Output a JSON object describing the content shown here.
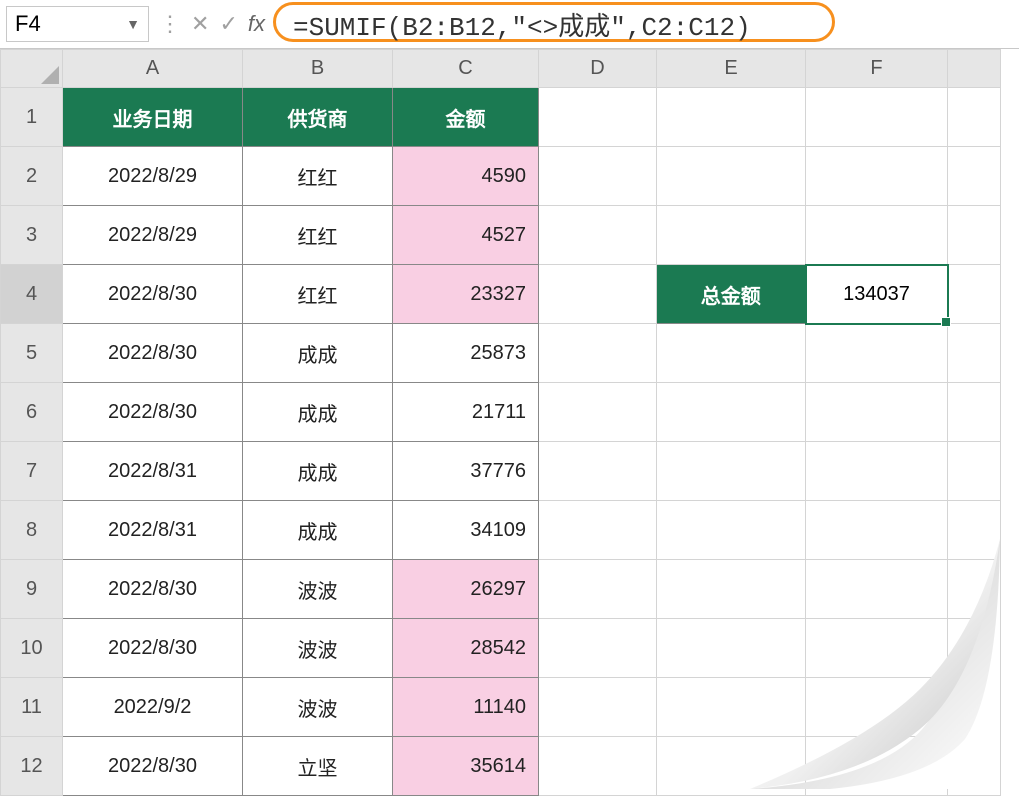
{
  "namebox": "F4",
  "formula": "=SUMIF(B2:B12,\"<>成成\",C2:C12)",
  "col_headers": [
    "A",
    "B",
    "C",
    "D",
    "E",
    "F"
  ],
  "headers": {
    "A": "业务日期",
    "B": "供货商",
    "C": "金额"
  },
  "side": {
    "label": "总金额",
    "value": "134037"
  },
  "rows": [
    {
      "n": "1",
      "type": "header"
    },
    {
      "n": "2",
      "date": "2022/8/29",
      "supplier": "红红",
      "amount": "4590",
      "hl": true
    },
    {
      "n": "3",
      "date": "2022/8/29",
      "supplier": "红红",
      "amount": "4527",
      "hl": true
    },
    {
      "n": "4",
      "date": "2022/8/30",
      "supplier": "红红",
      "amount": "23327",
      "hl": true,
      "sel": true
    },
    {
      "n": "5",
      "date": "2022/8/30",
      "supplier": "成成",
      "amount": "25873",
      "hl": false
    },
    {
      "n": "6",
      "date": "2022/8/30",
      "supplier": "成成",
      "amount": "21711",
      "hl": false
    },
    {
      "n": "7",
      "date": "2022/8/31",
      "supplier": "成成",
      "amount": "37776",
      "hl": false
    },
    {
      "n": "8",
      "date": "2022/8/31",
      "supplier": "成成",
      "amount": "34109",
      "hl": false
    },
    {
      "n": "9",
      "date": "2022/8/30",
      "supplier": "波波",
      "amount": "26297",
      "hl": true
    },
    {
      "n": "10",
      "date": "2022/8/30",
      "supplier": "波波",
      "amount": "28542",
      "hl": true
    },
    {
      "n": "11",
      "date": "2022/9/2",
      "supplier": "波波",
      "amount": "11140",
      "hl": true
    },
    {
      "n": "12",
      "date": "2022/8/30",
      "supplier": "立坚",
      "amount": "35614",
      "hl": true
    }
  ]
}
